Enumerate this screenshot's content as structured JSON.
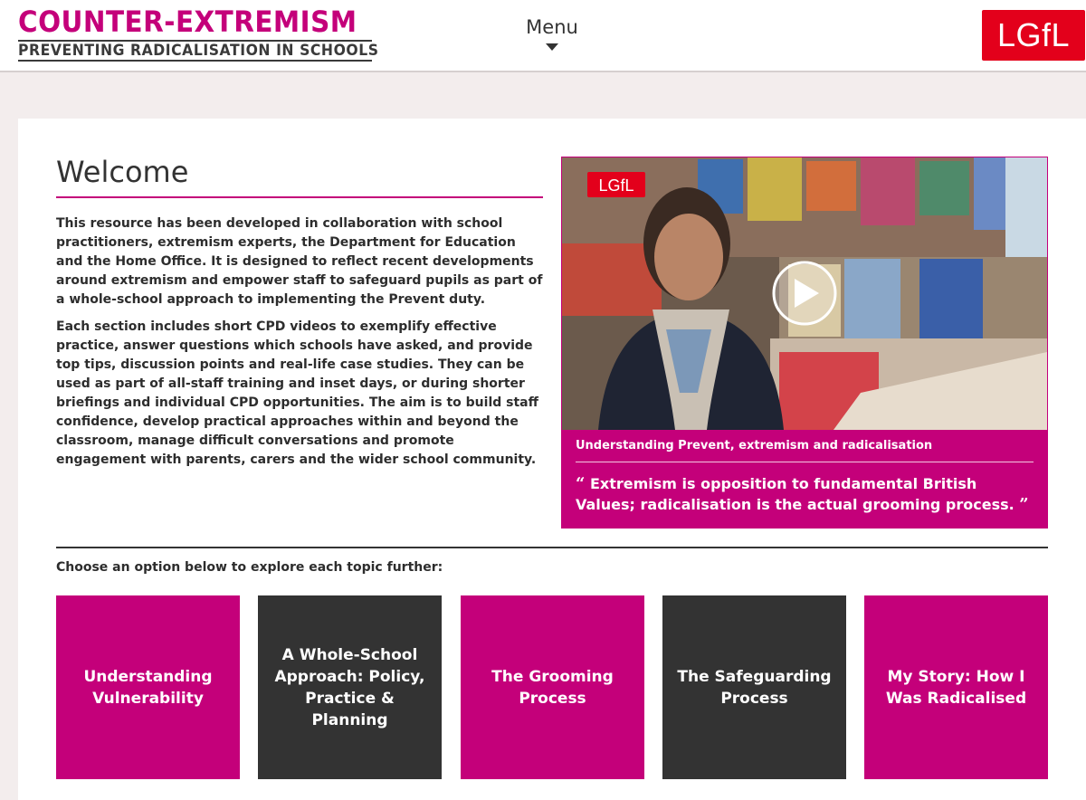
{
  "header": {
    "logo_title": "COUNTER-EXTREMISM",
    "logo_subtitle": "PREVENTING RADICALISATION IN SCHOOLS",
    "menu_label": "Menu",
    "brand_badge": "LGfL"
  },
  "welcome": {
    "title": "Welcome",
    "paragraph1": "This resource has been developed in collaboration with school practitioners, extremism experts, the Department for Education and the Home Office. It is designed to reflect recent developments around extremism and empower staff to safeguard pupils as part of a whole-school approach to implementing the Prevent duty.",
    "paragraph2": "Each section includes short CPD videos to exemplify effective practice, answer questions which schools have asked, and provide top tips, discussion points and real-life case studies. They can be used as part of all-staff training and inset days, or during shorter briefings and individual CPD opportunities. The aim is to build staff confidence, develop practical approaches within and beyond the classroom, manage difficult conversations and promote engagement with parents, carers and the wider school community."
  },
  "video": {
    "watermark": "LGfL",
    "caption": "Understanding Prevent, extremism and radicalisation",
    "quote": "Extremism is opposition to fundamental British Values; radicalisation is the actual grooming process.",
    "open_quote_mark": "“",
    "close_quote_mark": "”"
  },
  "choose_text": "Choose an option below to explore each topic further:",
  "tiles": [
    {
      "label": "Understanding Vulnerability",
      "style": "pink"
    },
    {
      "label": "A Whole-School Approach: Policy, Practice & Planning",
      "style": "dark"
    },
    {
      "label": "The Grooming Process",
      "style": "pink"
    },
    {
      "label": "The Safeguarding Process",
      "style": "dark"
    },
    {
      "label": "My Story: How I Was Radicalised",
      "style": "pink"
    }
  ],
  "colors": {
    "brand_magenta": "#c4007a",
    "dark_tile": "#333333",
    "lgfl_red": "#e3001b",
    "page_background": "#f3eded"
  },
  "icons": {
    "video_play": "play-icon",
    "menu_toggle": "caret-down-icon"
  }
}
